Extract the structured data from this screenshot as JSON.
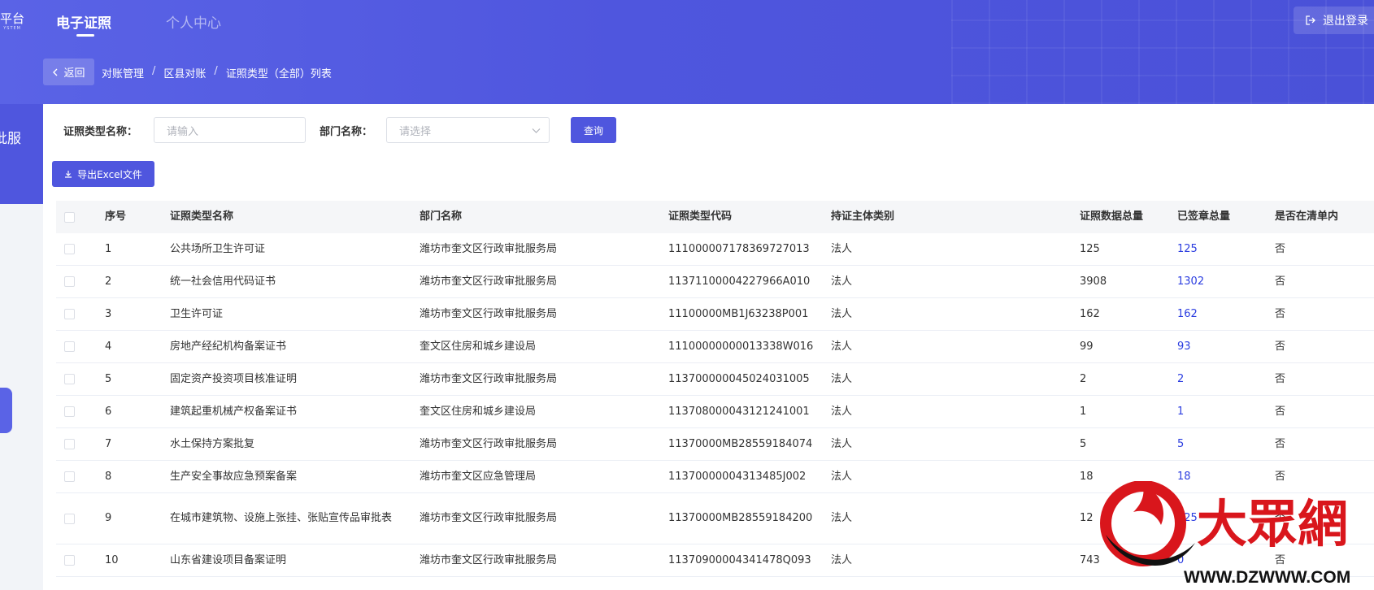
{
  "header": {
    "logo_text": "平台",
    "logo_sub": "YSTEM",
    "tabs": [
      {
        "label": "电子证照",
        "active": true
      },
      {
        "label": "个人中心",
        "active": false
      }
    ],
    "logout_label": "退出登录",
    "side_label": "批服"
  },
  "breadcrumb": {
    "back_label": "返回",
    "items": [
      "对账管理",
      "区县对账",
      "证照类型（全部）列表"
    ],
    "separator": "/"
  },
  "filters": {
    "cert_type_label": "证照类型名称：",
    "cert_type_placeholder": "请输入",
    "dept_label": "部门名称：",
    "dept_placeholder": "请选择",
    "query_label": "查询",
    "export_label": "导出Excel文件"
  },
  "table": {
    "columns": [
      "序号",
      "证照类型名称",
      "部门名称",
      "证照类型代码",
      "持证主体类别",
      "证照数据总量",
      "已签章总量",
      "是否在清单内"
    ],
    "rows": [
      {
        "idx": "1",
        "name": "公共场所卫生许可证",
        "dept": "潍坊市奎文区行政审批服务局",
        "code": "11100000717836972701​3",
        "type": "法人",
        "total": "125",
        "signed": "125",
        "inlist": "否"
      },
      {
        "idx": "2",
        "name": "统一社会信用代码证书",
        "dept": "潍坊市奎文区行政审批服务局",
        "code": "1137110000422796​6A010",
        "type": "法人",
        "total": "3908",
        "signed": "1302",
        "inlist": "否"
      },
      {
        "idx": "3",
        "name": "卫生许可证",
        "dept": "潍坊市奎文区行政审批服务局",
        "code": "11100000MB1J63238P001",
        "type": "法人",
        "total": "162",
        "signed": "162",
        "inlist": "否"
      },
      {
        "idx": "4",
        "name": "房地产经纪机构备案证书",
        "dept": "奎文区住房和城乡建设局",
        "code": "11100000000013338W016",
        "type": "法人",
        "total": "99",
        "signed": "93",
        "inlist": "否"
      },
      {
        "idx": "5",
        "name": "固定资产投资项目核准证明",
        "dept": "潍坊市奎文区行政审批服务局",
        "code": "113700000045024031005",
        "type": "法人",
        "total": "2",
        "signed": "2",
        "inlist": "否"
      },
      {
        "idx": "6",
        "name": "建筑起重机械产权备案证书",
        "dept": "奎文区住房和城乡建设局",
        "code": "113708000043121241001",
        "type": "法人",
        "total": "1",
        "signed": "1",
        "inlist": "否"
      },
      {
        "idx": "7",
        "name": "水土保持方案批复",
        "dept": "潍坊市奎文区行政审批服务局",
        "code": "11370000MB28559184074",
        "type": "法人",
        "total": "5",
        "signed": "5",
        "inlist": "否"
      },
      {
        "idx": "8",
        "name": "生产安全事故应急预案备案",
        "dept": "潍坊市奎文区应急管理局",
        "code": "11370000004313485J002",
        "type": "法人",
        "total": "18",
        "signed": "18",
        "inlist": "否"
      },
      {
        "idx": "9",
        "name": "在城市建筑物、设施上张挂、张贴宣传品审批表",
        "dept": "潍坊市奎文区行政审批服务局",
        "code": "11370000MB28559184200",
        "type": "法人",
        "total": "12",
        "signed": "125",
        "inlist": "否"
      },
      {
        "idx": "10",
        "name": "山东省建设项目备案证明",
        "dept": "潍坊市奎文区行政审批服务局",
        "code": "11370900004341478Q093",
        "type": "法人",
        "total": "743",
        "signed": "0",
        "inlist": "否"
      }
    ]
  },
  "watermark": {
    "brand": "大眾網",
    "url": "WWW.DZWWW.COM",
    "colors": {
      "red": "#d9161c",
      "black": "#111111"
    }
  },
  "colors": {
    "primary": "#4f56de",
    "link": "#2b3de0"
  }
}
